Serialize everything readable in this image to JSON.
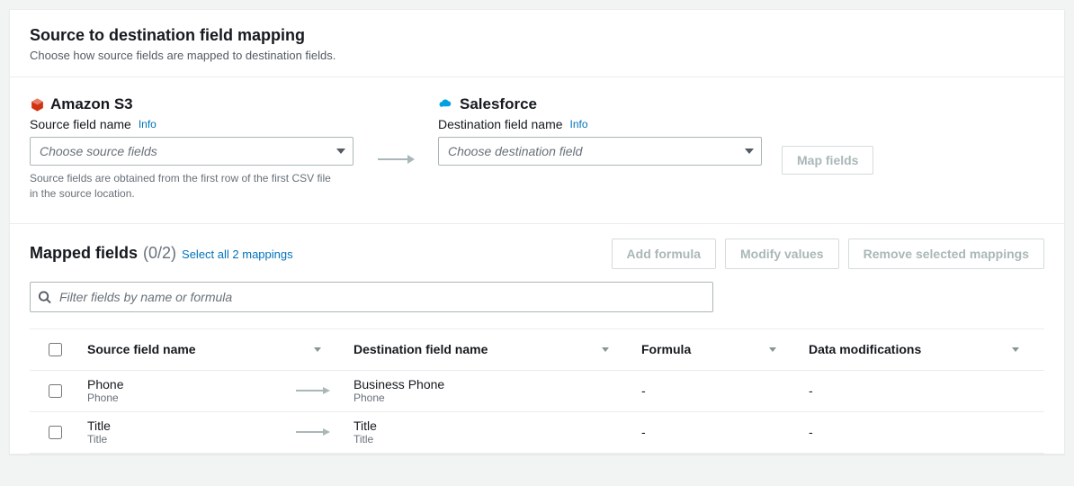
{
  "header": {
    "title": "Source to destination field mapping",
    "subtitle": "Choose how source fields are mapped to destination fields."
  },
  "source": {
    "service_name": "Amazon S3",
    "field_label": "Source field name",
    "info_label": "Info",
    "placeholder": "Choose source fields",
    "helper": "Source fields are obtained from the first row of the first CSV file in the source location."
  },
  "destination": {
    "service_name": "Salesforce",
    "field_label": "Destination field name",
    "info_label": "Info",
    "placeholder": "Choose destination field"
  },
  "map_button": "Map fields",
  "mapped": {
    "title": "Mapped fields",
    "count": "(0/2)",
    "select_all": "Select all 2 mappings",
    "actions": {
      "add_formula": "Add formula",
      "modify_values": "Modify values",
      "remove": "Remove selected mappings"
    },
    "filter_placeholder": "Filter fields by name or formula"
  },
  "table": {
    "headers": {
      "source": "Source field name",
      "destination": "Destination field name",
      "formula": "Formula",
      "mods": "Data modifications"
    },
    "rows": [
      {
        "src_name": "Phone",
        "src_sub": "Phone",
        "dst_name": "Business Phone",
        "dst_sub": "Phone",
        "formula": "-",
        "mods": "-"
      },
      {
        "src_name": "Title",
        "src_sub": "Title",
        "dst_name": "Title",
        "dst_sub": "Title",
        "formula": "-",
        "mods": "-"
      }
    ]
  }
}
